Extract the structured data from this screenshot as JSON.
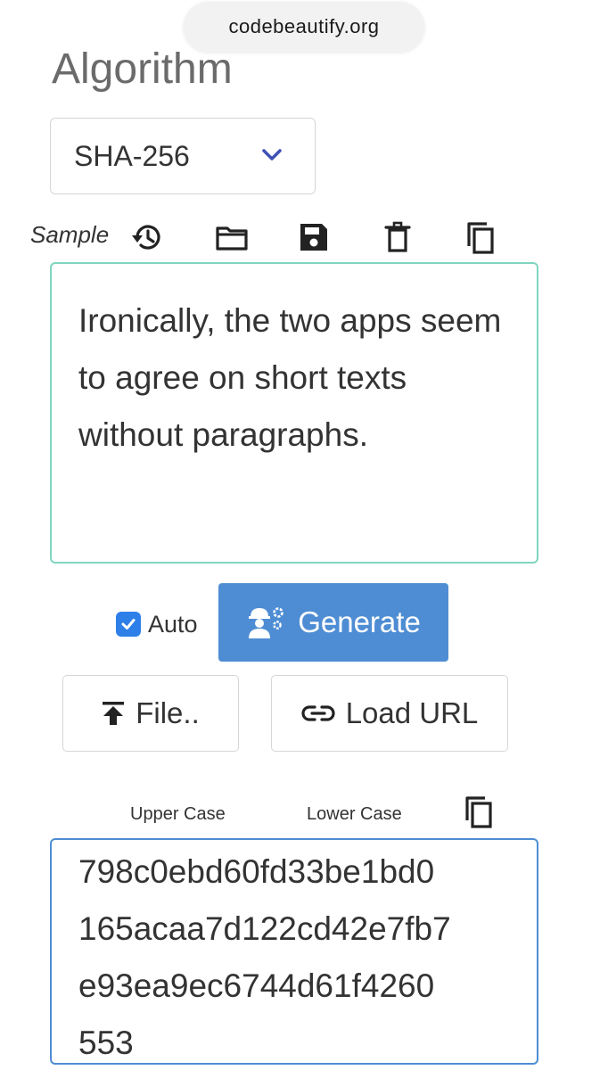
{
  "browser": {
    "url": "codebeautify.org"
  },
  "algorithm": {
    "heading": "Algorithm",
    "selected": "SHA-256",
    "accent_color": "#3f51b5"
  },
  "toolbar": {
    "sample_label": "Sample",
    "icons": [
      "history-icon",
      "folder-icon",
      "save-icon",
      "delete-icon",
      "copy-icon"
    ]
  },
  "input": {
    "text": "Ironically, the two apps seem to agree on short texts without paragraphs.",
    "border_color": "#7fd6c0"
  },
  "controls": {
    "auto_label": "Auto",
    "auto_checked": true,
    "generate_label": "Generate",
    "generate_color": "#4e8dd3",
    "file_label": "File..",
    "load_url_label": "Load URL"
  },
  "output": {
    "upper_case_label": "Upper Case",
    "lower_case_label": "Lower Case",
    "lines": [
      "798c0ebd60fd33be1bd0",
      "165acaa7d122cd42e7fb7",
      "e93ea9ec6744d61f4260",
      "553"
    ]
  }
}
